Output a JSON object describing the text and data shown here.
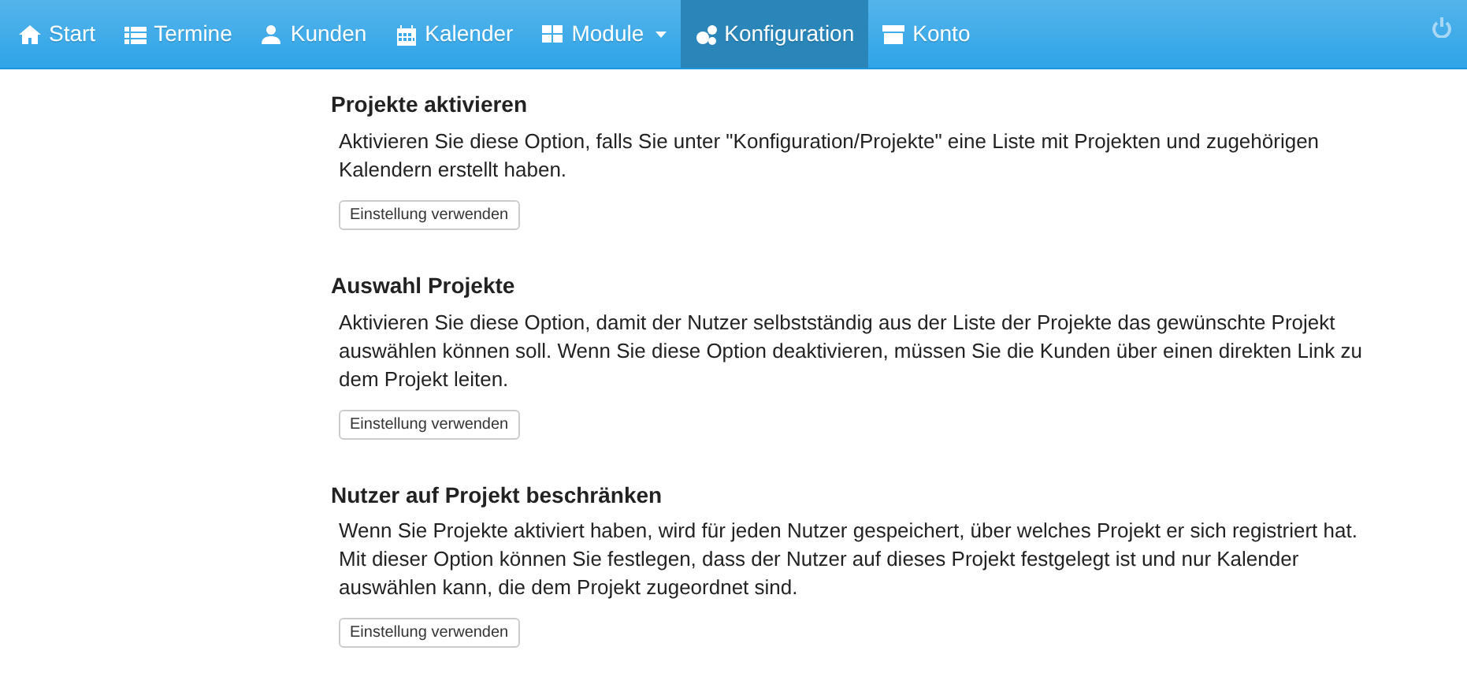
{
  "navbar": {
    "items": [
      {
        "label": "Start",
        "selected": false,
        "dropdown": false
      },
      {
        "label": "Termine",
        "selected": false,
        "dropdown": false
      },
      {
        "label": "Kunden",
        "selected": false,
        "dropdown": false
      },
      {
        "label": "Kalender",
        "selected": false,
        "dropdown": false
      },
      {
        "label": "Module",
        "selected": false,
        "dropdown": true
      },
      {
        "label": "Konfiguration",
        "selected": true,
        "dropdown": false
      },
      {
        "label": "Konto",
        "selected": false,
        "dropdown": false
      }
    ]
  },
  "sections": [
    {
      "title": "Projekte aktivieren",
      "description": "Aktivieren Sie diese Option, falls Sie unter \"Konfiguration/Projekte\" eine Liste mit Projekten und zugehörigen Kalendern erstellt haben.",
      "button": "Einstellung verwenden"
    },
    {
      "title": "Auswahl Projekte",
      "description": "Aktivieren Sie diese Option, damit der Nutzer selbstständig aus der Liste der Projekte das gewünschte Projekt auswählen können soll. Wenn Sie diese Option deaktivieren, müssen Sie die Kunden über einen direkten Link zu dem Projekt leiten.",
      "button": "Einstellung verwenden"
    },
    {
      "title": "Nutzer auf Projekt beschränken",
      "description": "Wenn Sie Projekte aktiviert haben, wird für jeden Nutzer gespeichert, über welches Projekt er sich registriert hat. Mit dieser Option können Sie festlegen, dass der Nutzer auf dieses Projekt festgelegt ist und nur Kalender auswählen kann, die dem Projekt zugeordnet sind.",
      "button": "Einstellung verwenden"
    }
  ]
}
